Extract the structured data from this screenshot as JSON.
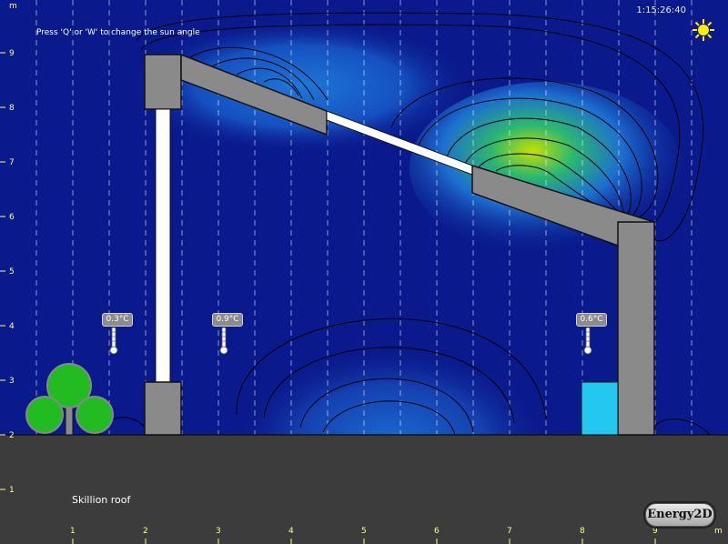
{
  "app": {
    "hint": "Press 'Q' or 'W' to change the sun angle",
    "clock": "1:15:26:40",
    "model_name": "Skillion roof",
    "logo": "Energy2D"
  },
  "axes": {
    "y_unit": "m",
    "x_unit": "m",
    "y_ticks": [
      "1",
      "2",
      "3",
      "4",
      "5",
      "6",
      "7",
      "8",
      "9"
    ],
    "x_ticks": [
      "1",
      "2",
      "3",
      "4",
      "5",
      "6",
      "7",
      "8",
      "9"
    ]
  },
  "thermometers": [
    {
      "label": "0.3°C"
    },
    {
      "label": "0.9°C"
    },
    {
      "label": "0.6°C"
    }
  ],
  "colors": {
    "background": "#0a1a8c",
    "ground": "#3c3c3c",
    "wall": "#8a8a8a",
    "window": "#ffffff",
    "tank": "#22c8f0",
    "tree": "#22bb22",
    "sun": "#ffee00"
  },
  "icons": {
    "sun": "sun-icon",
    "tree": "tree-icon",
    "thermometer": "thermometer-icon"
  }
}
